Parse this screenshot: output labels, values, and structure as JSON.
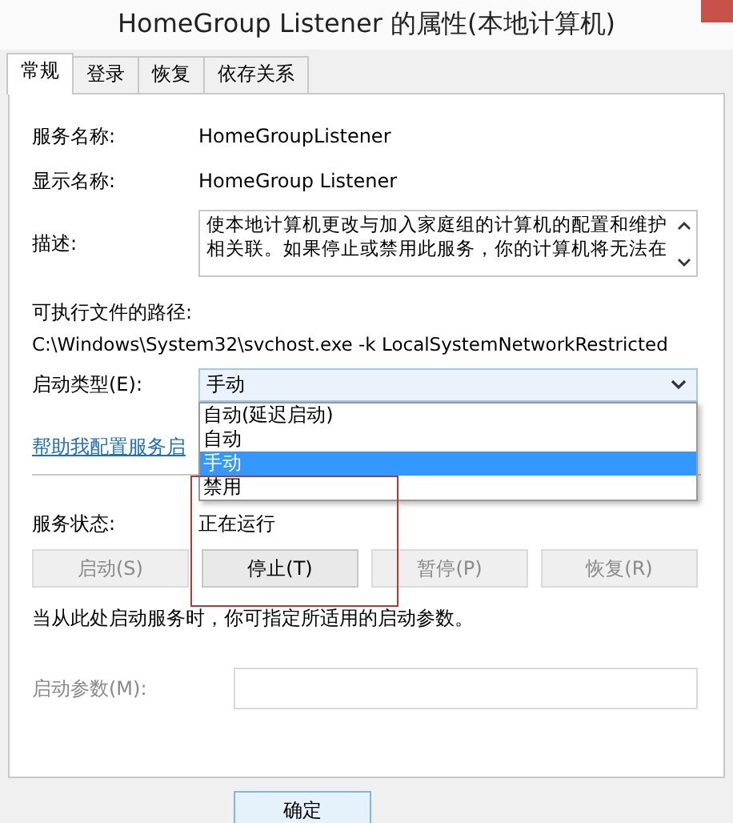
{
  "window": {
    "title": "HomeGroup Listener 的属性(本地计算机)"
  },
  "tabs": [
    {
      "label": "常规",
      "selected": true
    },
    {
      "label": "登录",
      "selected": false
    },
    {
      "label": "恢复",
      "selected": false
    },
    {
      "label": "依存关系",
      "selected": false
    }
  ],
  "service_name": {
    "label": "服务名称:",
    "value": "HomeGroupListener"
  },
  "display_name": {
    "label": "显示名称:",
    "value": "HomeGroup Listener"
  },
  "description": {
    "label": "描述:",
    "value": "使本地计算机更改与加入家庭组的计算机的配置和维护相关联。如果停止或禁用此服务，你的计算机将无法在"
  },
  "executable_path": {
    "label": "可执行文件的路径:",
    "value": "C:\\Windows\\System32\\svchost.exe -k LocalSystemNetworkRestricted"
  },
  "startup_type": {
    "label": "启动类型(E):",
    "value": "手动",
    "expanded": true,
    "options": [
      {
        "label": "自动(延迟启动)",
        "selected": false
      },
      {
        "label": "自动",
        "selected": false
      },
      {
        "label": "手动",
        "selected": true
      },
      {
        "label": "禁用",
        "selected": false
      }
    ]
  },
  "help_link": "帮助我配置服务启",
  "service_status": {
    "label": "服务状态:",
    "value": "正在运行"
  },
  "control_buttons": [
    {
      "label": "启动(S)",
      "disabled": true
    },
    {
      "label": "停止(T)",
      "disabled": false
    },
    {
      "label": "暂停(P)",
      "disabled": true
    },
    {
      "label": "恢复(R)",
      "disabled": true
    }
  ],
  "hint": "当从此处启动服务时，你可指定所适用的启动参数。",
  "start_parameters": {
    "label": "启动参数(M):",
    "disabled": true
  },
  "buttons": [
    "确定"
  ]
}
